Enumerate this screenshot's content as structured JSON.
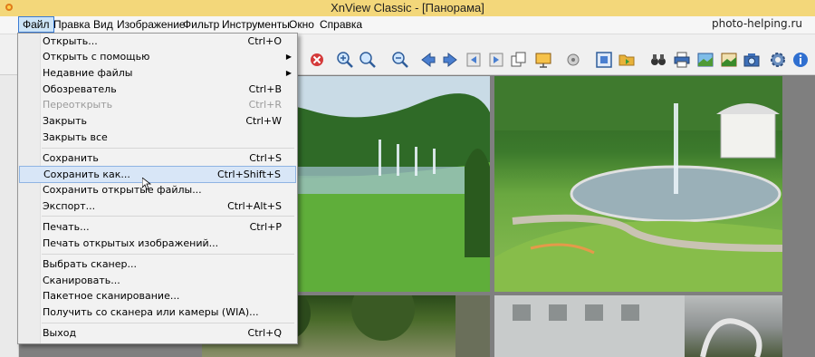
{
  "window": {
    "title": "XnView Classic - [Панорама]",
    "watermark": "photo-helping.ru",
    "titlebar_color": "#f3d77a"
  },
  "menubar": {
    "items": [
      "Файл",
      "Правка",
      "Вид",
      "Изображение",
      "Фильтр",
      "Инструменты",
      "Окно",
      "Справка"
    ],
    "active_index": 0
  },
  "file_menu": {
    "items": [
      {
        "label": "Открыть...",
        "shortcut": "Ctrl+O",
        "submenu": false,
        "disabled": false
      },
      {
        "label": "Открыть с помощью",
        "shortcut": "",
        "submenu": true,
        "disabled": false
      },
      {
        "label": "Недавние файлы",
        "shortcut": "",
        "submenu": true,
        "disabled": false
      },
      {
        "label": "Обозреватель",
        "shortcut": "Ctrl+B",
        "submenu": false,
        "disabled": false
      },
      {
        "label": "Переоткрыть",
        "shortcut": "Ctrl+R",
        "submenu": false,
        "disabled": true
      },
      {
        "label": "Закрыть",
        "shortcut": "Ctrl+W",
        "submenu": false,
        "disabled": false
      },
      {
        "label": "Закрыть все",
        "shortcut": "",
        "submenu": false,
        "disabled": false
      },
      {
        "label": "Сохранить",
        "shortcut": "Ctrl+S",
        "submenu": false,
        "disabled": false
      },
      {
        "label": "Сохранить как...",
        "shortcut": "Ctrl+Shift+S",
        "submenu": false,
        "disabled": false,
        "highlighted": true
      },
      {
        "label": "Сохранить открытые файлы...",
        "shortcut": "",
        "submenu": false,
        "disabled": false
      },
      {
        "label": "Экспорт...",
        "shortcut": "Ctrl+Alt+S",
        "submenu": false,
        "disabled": false
      },
      {
        "label": "Печать...",
        "shortcut": "Ctrl+P",
        "submenu": false,
        "disabled": false
      },
      {
        "label": "Печать открытых изображений...",
        "shortcut": "",
        "submenu": false,
        "disabled": false
      },
      {
        "label": "Выбрать сканер...",
        "shortcut": "",
        "submenu": false,
        "disabled": false
      },
      {
        "label": "Сканировать...",
        "shortcut": "",
        "submenu": false,
        "disabled": false
      },
      {
        "label": "Пакетное сканирование...",
        "shortcut": "",
        "submenu": false,
        "disabled": false
      },
      {
        "label": "Получить со сканера или камеры (WIA)...",
        "shortcut": "",
        "submenu": false,
        "disabled": false
      },
      {
        "label": "Выход",
        "shortcut": "Ctrl+Q",
        "submenu": false,
        "disabled": false
      }
    ]
  },
  "toolbar": {
    "icons": [
      "delete-icon",
      "zoom-in-icon",
      "zoom-tool-icon",
      "zoom-out-icon",
      "arrow-left-icon",
      "arrow-right-icon",
      "first-page-icon",
      "last-page-icon",
      "copy-icon",
      "slideshow-icon",
      "settings-small-icon",
      "fullscreen-icon",
      "open-folder-icon",
      "binoculars-icon",
      "printer-icon",
      "image-export-icon",
      "camera-icon",
      "gear-icon",
      "info-icon"
    ]
  },
  "colors": {
    "menu_highlight": "#d8e6f7",
    "menubar_active": "#cce4f7",
    "canvas_bg": "#7f7f7f"
  }
}
